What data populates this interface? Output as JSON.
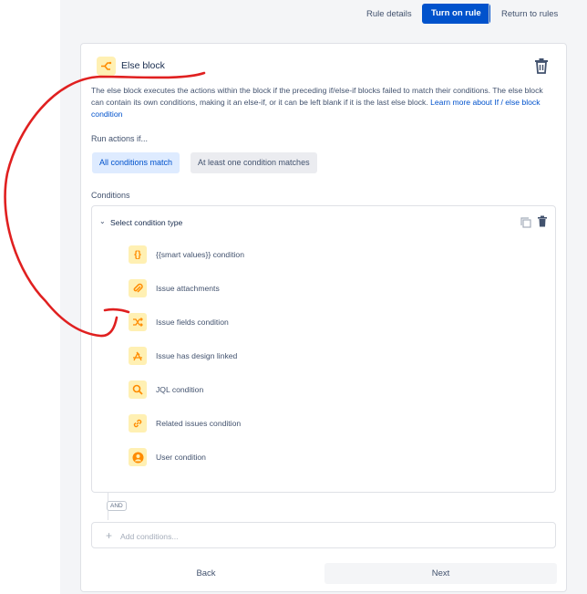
{
  "topbar": {
    "rule_details": "Rule details",
    "turn_on_rule": "Turn on rule",
    "return_to_rules": "Return to rules"
  },
  "block": {
    "title": "Else block",
    "description": "The else block executes the actions within the block if the preceding if/else-if blocks failed to match their conditions. The else block can contain its own conditions, making it an else-if, or it can be left blank if it is the last else block.",
    "learn_more": "Learn more about If / else block condition"
  },
  "run_actions": {
    "label": "Run actions if...",
    "options": [
      "All conditions match",
      "At least one condition matches"
    ],
    "selected": "All conditions match"
  },
  "conditions": {
    "label": "Conditions",
    "select_type": "Select condition type",
    "items": [
      {
        "label": "{{smart values}} condition",
        "icon": "smart-values-icon"
      },
      {
        "label": "Issue attachments",
        "icon": "paperclip-icon"
      },
      {
        "label": "Issue fields condition",
        "icon": "shuffle-icon"
      },
      {
        "label": "Issue has design linked",
        "icon": "design-icon"
      },
      {
        "label": "JQL condition",
        "icon": "search-icon"
      },
      {
        "label": "Related issues condition",
        "icon": "link-icon"
      },
      {
        "label": "User condition",
        "icon": "user-icon"
      }
    ]
  },
  "and_badge": "AND",
  "add_conditions": "Add conditions...",
  "footer": {
    "back": "Back",
    "next": "Next"
  },
  "colors": {
    "accent": "#0052cc",
    "icon_bg": "#fff0b3",
    "icon_fg": "#ff8b00",
    "annotation": "#e02020"
  }
}
